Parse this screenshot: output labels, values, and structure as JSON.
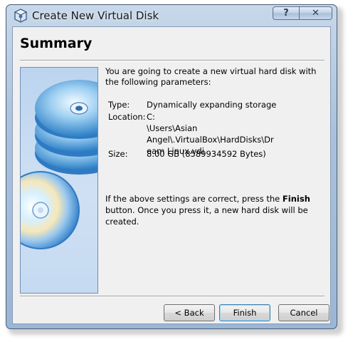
{
  "window": {
    "title": "Create New Virtual Disk",
    "help_label": "?",
    "close_label": "✕"
  },
  "page": {
    "heading": "Summary",
    "intro": "You are going to create a new virtual hard disk with the following parameters:",
    "params": [
      {
        "label": "Type:",
        "value": "Dynamically expanding storage"
      },
      {
        "label": "Location:",
        "value": "C:\n\\Users\\Asian Angel\\.VirtualBox\\HardDisks\\Dr\neam Linux.vdi"
      },
      {
        "label": "Size:",
        "value": "8.00 GB (8589934592 Bytes)"
      }
    ],
    "outro_before": "If the above settings are correct, press the ",
    "outro_bold": "Finish",
    "outro_after": " button. Once you press it, a new hard disk will be created."
  },
  "buttons": {
    "back": "< Back",
    "finish": "Finish",
    "cancel": "Cancel"
  },
  "colors": {
    "titlebar": "#a9c1dc",
    "client_bg": "#f0f0f0",
    "image_bg": "#c5daf1"
  },
  "icons": {
    "title": "virtualbox-cube-icon",
    "image": "stacked-discs-illustration"
  }
}
